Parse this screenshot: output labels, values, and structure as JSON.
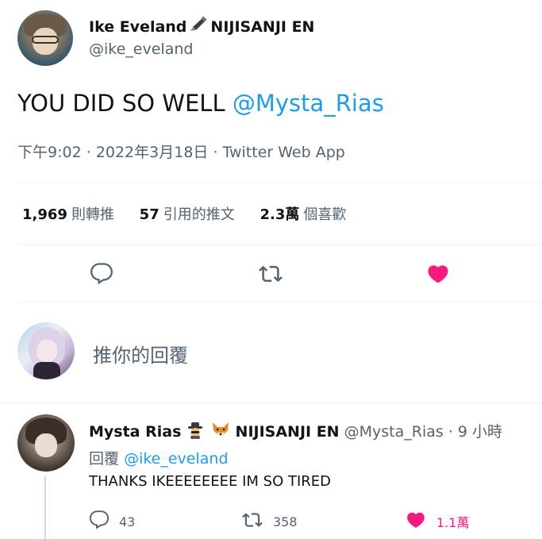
{
  "tweet": {
    "author": {
      "name": "Ike Eveland",
      "name_suffix": "NIJISANJI EN",
      "handle": "@ike_eveland"
    },
    "text": "YOU DID SO WELL ",
    "mention": "@Mysta_Rias",
    "timestamp": "下午9:02 · 2022年3月18日 · Twitter Web App",
    "stats": {
      "retweets": {
        "value": "1,969",
        "label": "則轉推"
      },
      "quotes": {
        "value": "57",
        "label": "引用的推文"
      },
      "likes": {
        "value": "2.3萬",
        "label": "個喜歡"
      }
    },
    "liked": true
  },
  "composer": {
    "placeholder": "推你的回覆"
  },
  "reply": {
    "author": {
      "name": "Mysta Rias",
      "name_suffix": "NIJISANJI EN",
      "handle": "@Mysta_Rias",
      "time": "· 9 小時"
    },
    "replying_label": "回覆",
    "replying_to": "@ike_eveland",
    "text": "THANKS IKEEEEEEEE IM SO TIRED",
    "counts": {
      "replies": "43",
      "retweets": "358",
      "likes": "1.1萬"
    }
  },
  "colors": {
    "accent": "#1d9bf0",
    "like": "#f91880",
    "secondary_text": "#536471"
  }
}
